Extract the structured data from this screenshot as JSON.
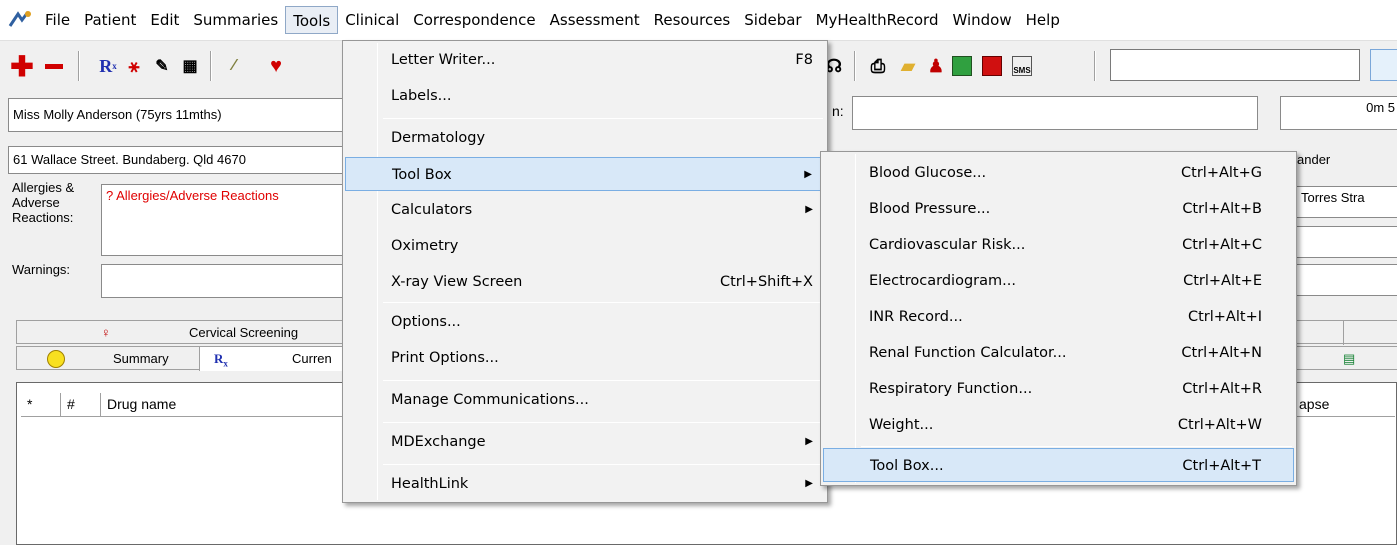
{
  "menubar": {
    "items": [
      "File",
      "Patient",
      "Edit",
      "Summaries",
      "Tools",
      "Clinical",
      "Correspondence",
      "Assessment",
      "Resources",
      "Sidebar",
      "MyHealthRecord",
      "Window",
      "Help"
    ],
    "active": "Tools"
  },
  "patient": {
    "name": "Miss Molly Anderson (75yrs 11mths)",
    "address": "61 Wallace Street. Bundaberg. Qld  4670",
    "allergies_label": "Allergies & Adverse Reactions:",
    "allergies_value": "? Allergies/Adverse Reactions",
    "warnings_label": "Warnings:",
    "right_fragment_1": "n:",
    "right_fragment_2": "0m 5",
    "right_fragment_3": "ander",
    "right_fragment_4": "Torres Stra"
  },
  "tabs": {
    "cervical": "Cervical Screening",
    "summary": "Summary",
    "current": "Curren"
  },
  "grid": {
    "columns": [
      "*",
      "#",
      "Drug name"
    ],
    "right_fragment": "apse"
  },
  "tools_menu": {
    "items": [
      {
        "label": "Letter Writer...",
        "shortcut": "F8"
      },
      {
        "label": "Labels...",
        "shortcut": ""
      },
      {
        "label": "Dermatology",
        "shortcut": ""
      },
      {
        "label": "Tool Box",
        "shortcut": "",
        "submenu": true
      },
      {
        "label": "Calculators",
        "shortcut": "",
        "submenu": true
      },
      {
        "label": "Oximetry",
        "shortcut": ""
      },
      {
        "label": "X-ray View Screen",
        "shortcut": "Ctrl+Shift+X"
      },
      {
        "label": "Options...",
        "shortcut": ""
      },
      {
        "label": "Print Options...",
        "shortcut": ""
      },
      {
        "label": "Manage Communications...",
        "shortcut": ""
      },
      {
        "label": "MDExchange",
        "shortcut": "",
        "submenu": true
      },
      {
        "label": "HealthLink",
        "shortcut": "",
        "submenu": true
      }
    ]
  },
  "toolbox_menu": {
    "items": [
      {
        "label": "Blood Glucose...",
        "shortcut": "Ctrl+Alt+G"
      },
      {
        "label": "Blood Pressure...",
        "shortcut": "Ctrl+Alt+B"
      },
      {
        "label": "Cardiovascular Risk...",
        "shortcut": "Ctrl+Alt+C"
      },
      {
        "label": "Electrocardiogram...",
        "shortcut": "Ctrl+Alt+E"
      },
      {
        "label": "INR Record...",
        "shortcut": "Ctrl+Alt+I"
      },
      {
        "label": "Renal Function Calculator...",
        "shortcut": "Ctrl+Alt+N"
      },
      {
        "label": "Respiratory Function...",
        "shortcut": "Ctrl+Alt+R"
      },
      {
        "label": "Weight...",
        "shortcut": "Ctrl+Alt+W"
      },
      {
        "label": "Tool Box...",
        "shortcut": "Ctrl+Alt+T"
      }
    ]
  },
  "colors": {
    "highlight": "#d8e8f8",
    "highlight_border": "#7aaee3",
    "allergy": "#e00000"
  }
}
